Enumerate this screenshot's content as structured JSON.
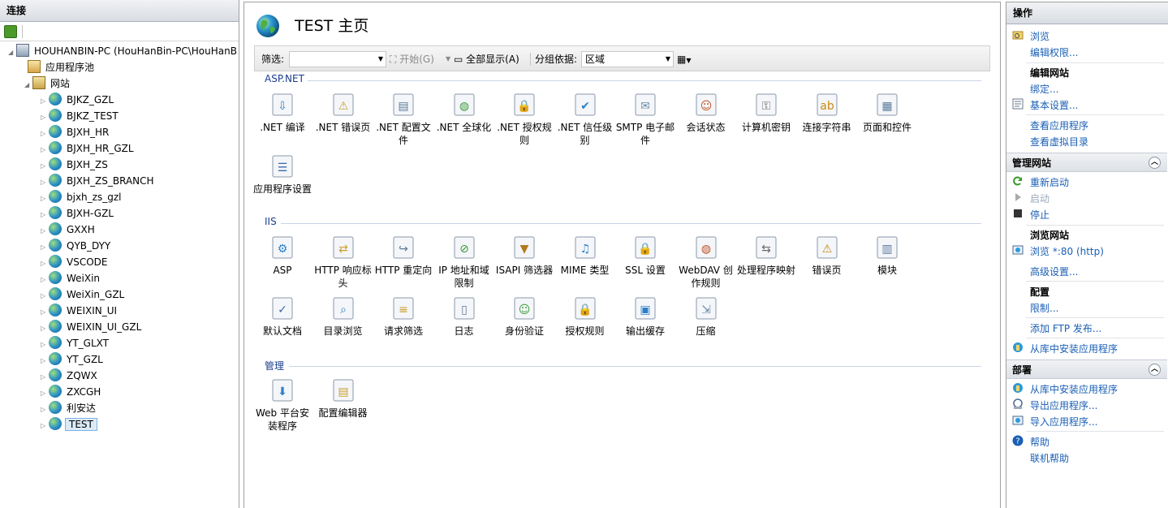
{
  "connections": {
    "title": "连接",
    "server": "HOUHANBIN-PC (HouHanBin-PC\\HouHanB",
    "app_pools": "应用程序池",
    "sites_label": "网站",
    "sites": [
      "BJKZ_GZL",
      "BJKZ_TEST",
      "BJXH_HR",
      "BJXH_HR_GZL",
      "BJXH_ZS",
      "BJXH_ZS_BRANCH",
      "bjxh_zs_gzl",
      "BJXH-GZL",
      "GXXH",
      "QYB_DYY",
      "VSCODE",
      "WeiXin",
      "WeiXin_GZL",
      "WEIXIN_UI",
      "WEIXIN_UI_GZL",
      "YT_GLXT",
      "YT_GZL",
      "ZQWX",
      "ZXCGH",
      "利安达",
      "TEST"
    ],
    "selected": "TEST"
  },
  "main": {
    "title": "TEST 主页",
    "filter_label": "筛选:",
    "start_label": "开始(G)",
    "show_all_label": "全部显示(A)",
    "group_by_label": "分组依据:",
    "group_by_value": "区域",
    "groups": [
      {
        "name": "ASP.NET",
        "items": [
          {
            "label": ".NET 编译",
            "icon": "dotnet-compile-icon"
          },
          {
            "label": ".NET 错误页",
            "icon": "error-page-404-icon"
          },
          {
            "label": ".NET 配置文件",
            "icon": "config-file-icon"
          },
          {
            "label": ".NET 全球化",
            "icon": "globe-icon"
          },
          {
            "label": ".NET 授权规则",
            "icon": "lock-doc-icon"
          },
          {
            "label": ".NET 信任级别",
            "icon": "trust-check-icon"
          },
          {
            "label": "SMTP 电子邮件",
            "icon": "mail-icon"
          },
          {
            "label": "会话状态",
            "icon": "session-user-icon"
          },
          {
            "label": "计算机密钥",
            "icon": "machine-key-icon"
          },
          {
            "label": "连接字符串",
            "icon": "db-string-icon"
          },
          {
            "label": "页面和控件",
            "icon": "page-controls-icon"
          },
          {
            "label": "应用程序设置",
            "icon": "app-settings-icon"
          }
        ]
      },
      {
        "name": "IIS",
        "items": [
          {
            "label": "ASP",
            "icon": "asp-icon"
          },
          {
            "label": "HTTP 响应标头",
            "icon": "http-headers-icon"
          },
          {
            "label": "HTTP 重定向",
            "icon": "redirect-icon"
          },
          {
            "label": "IP 地址和域限制",
            "icon": "ip-restrict-icon"
          },
          {
            "label": "ISAPI 筛选器",
            "icon": "isapi-filter-icon"
          },
          {
            "label": "MIME 类型",
            "icon": "mime-icon"
          },
          {
            "label": "SSL 设置",
            "icon": "ssl-lock-icon"
          },
          {
            "label": "WebDAV 创作规则",
            "icon": "webdav-icon"
          },
          {
            "label": "处理程序映射",
            "icon": "handler-map-icon"
          },
          {
            "label": "错误页",
            "icon": "error-page-icon"
          },
          {
            "label": "模块",
            "icon": "modules-icon"
          },
          {
            "label": "默认文档",
            "icon": "default-doc-icon"
          },
          {
            "label": "目录浏览",
            "icon": "dir-browse-icon"
          },
          {
            "label": "请求筛选",
            "icon": "request-filter-icon"
          },
          {
            "label": "日志",
            "icon": "log-icon"
          },
          {
            "label": "身份验证",
            "icon": "auth-icon"
          },
          {
            "label": "授权规则",
            "icon": "authz-icon"
          },
          {
            "label": "输出缓存",
            "icon": "output-cache-icon"
          },
          {
            "label": "压缩",
            "icon": "compress-icon"
          }
        ]
      },
      {
        "name": "管理",
        "items": [
          {
            "label": "Web 平台安装程序",
            "icon": "web-pi-icon"
          },
          {
            "label": "配置编辑器",
            "icon": "config-editor-icon"
          }
        ]
      }
    ]
  },
  "actions": {
    "title": "操作",
    "browse": "浏览",
    "edit_perms": "编辑权限...",
    "edit_site": "编辑网站",
    "bindings": "绑定...",
    "basic_settings": "基本设置...",
    "view_apps": "查看应用程序",
    "view_vdirs": "查看虚拟目录",
    "manage_site": "管理网站",
    "restart": "重新启动",
    "start": "启动",
    "stop": "停止",
    "browse_site": "浏览网站",
    "browse_80": "浏览 *:80 (http)",
    "advanced": "高级设置...",
    "config": "配置",
    "limits": "限制...",
    "add_ftp": "添加 FTP 发布...",
    "install_from_gallery": "从库中安装应用程序",
    "deploy": "部署",
    "deploy_install": "从库中安装应用程序",
    "export_app": "导出应用程序...",
    "import_app": "导入应用程序...",
    "help": "帮助",
    "online_help": "联机帮助"
  },
  "colors": {
    "link": "#1a5fb4",
    "group_title": "#1a3e8c"
  }
}
